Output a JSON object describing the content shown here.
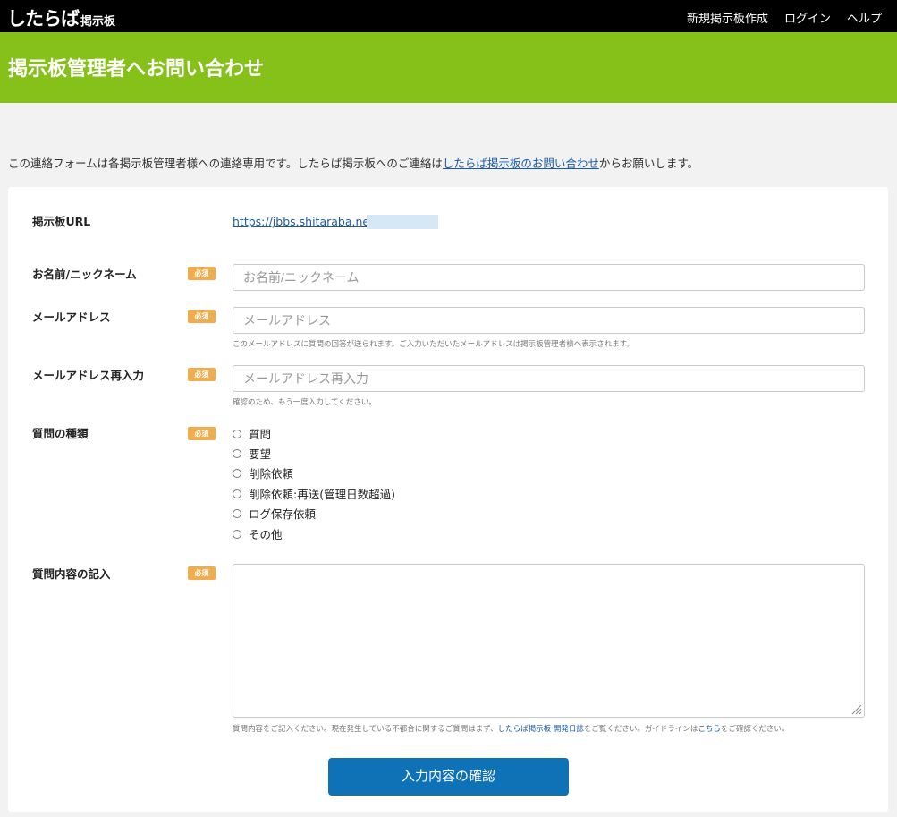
{
  "header": {
    "logo_main": "したらば",
    "logo_sub": "掲示板",
    "nav": [
      "新規掲示板作成",
      "ログイン",
      "ヘルプ"
    ]
  },
  "page_title": "掲示板管理者へお問い合わせ",
  "intro": {
    "before": "この連絡フォームは各掲示板管理者様への連絡専用です。したらば掲示板へのご連絡は",
    "link": "したらば掲示板のお問い合わせ",
    "after": "からお願いします。"
  },
  "required_badge": "必須",
  "form": {
    "bbs_url": {
      "label": "掲示板URL",
      "value": "https://jbbs.shitaraba.net/"
    },
    "name": {
      "label": "お名前/ニックネーム",
      "placeholder": "お名前/ニックネーム"
    },
    "email": {
      "label": "メールアドレス",
      "placeholder": "メールアドレス",
      "help": "このメールアドレスに質問の回答が送られます。ご入力いただいたメールアドレスは掲示板管理者様へ表示されます。"
    },
    "email_confirm": {
      "label": "メールアドレス再入力",
      "placeholder": "メールアドレス再入力",
      "help": "確認のため、もう一度入力してください。"
    },
    "question_type": {
      "label": "質問の種類",
      "options": [
        "質問",
        "要望",
        "削除依頼",
        "削除依頼:再送(管理日数超過)",
        "ログ保存依頼",
        "その他"
      ]
    },
    "content": {
      "label": "質問内容の記入",
      "help_before": "質問内容をご記入ください。現在発生している不都合に関するご質問はまず、",
      "help_link1": "したらば掲示板 開発日誌",
      "help_middle": "をご覧ください。ガイドラインは",
      "help_link2": "こちら",
      "help_after": "をご確認ください。"
    },
    "submit_label": "入力内容の確認"
  }
}
